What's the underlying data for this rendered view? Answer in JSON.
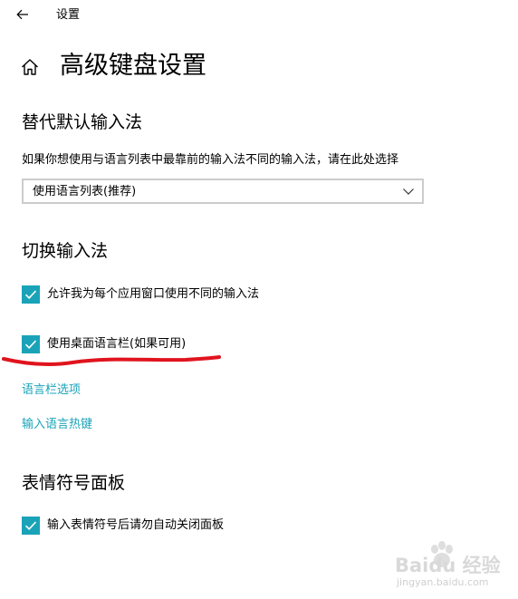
{
  "app": {
    "title": "设置"
  },
  "page": {
    "title": "高级键盘设置"
  },
  "sections": {
    "override_input": {
      "title": "替代默认输入法",
      "description": "如果你想使用与语言列表中最靠前的输入法不同的输入法，请在此处选择",
      "dropdown": {
        "selected": "使用语言列表(推荐)"
      }
    },
    "switch_input": {
      "title": "切换输入法",
      "per_app_checkbox": {
        "label": "允许我为每个应用窗口使用不同的输入法",
        "checked": true
      },
      "desktop_langbar_checkbox": {
        "label": "使用桌面语言栏(如果可用)",
        "checked": true
      },
      "links": {
        "language_bar_options": "语言栏选项",
        "input_language_hotkeys": "输入语言热键"
      }
    },
    "emoji_panel": {
      "title": "表情符号面板",
      "auto_close_checkbox": {
        "label": "输入表情符号后请勿自动关闭面板",
        "checked": true
      }
    }
  },
  "watermark": {
    "brand": "Baidu 经验",
    "url": "jingyan.baidu.com"
  },
  "colors": {
    "accent": "#1aa3b8",
    "annotation": "#e0141e",
    "border": "#cccccc"
  },
  "icons": {
    "back": "back-arrow-icon",
    "home": "home-icon",
    "dropdown": "chevron-down-icon",
    "check": "checkmark-icon"
  }
}
